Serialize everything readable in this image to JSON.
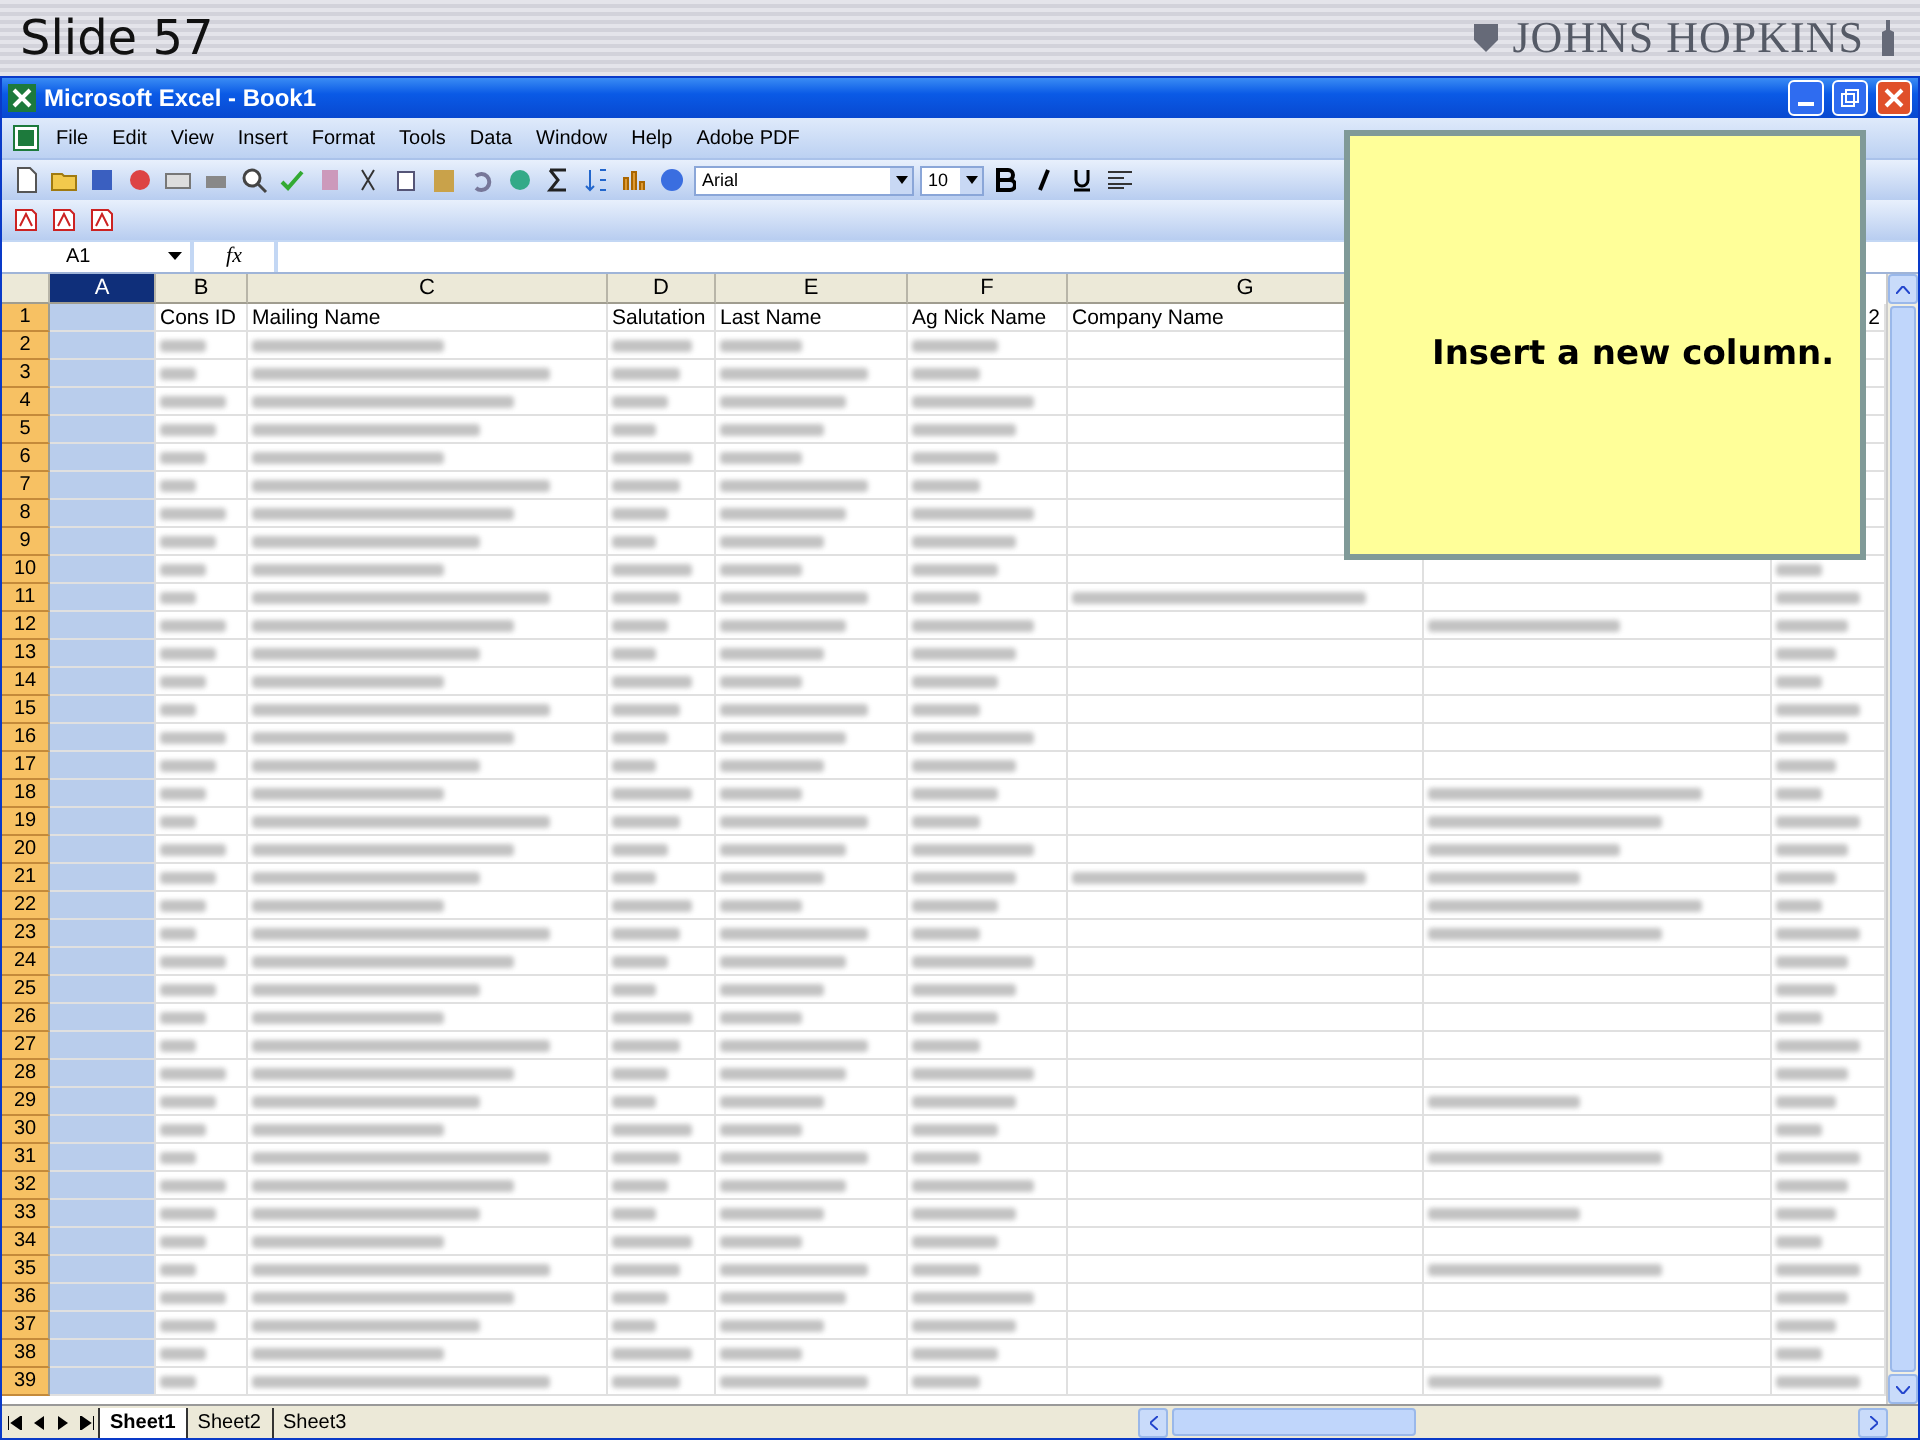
{
  "slide": {
    "title": "Slide 57",
    "logo": "JOHNS HOPKINS"
  },
  "window": {
    "title": "Microsoft Excel - Book1"
  },
  "menu": [
    "File",
    "Edit",
    "View",
    "Insert",
    "Format",
    "Tools",
    "Data",
    "Window",
    "Help",
    "Adobe PDF"
  ],
  "formatting": {
    "font": "Arial",
    "size": "10"
  },
  "name_box": "A1",
  "formula_label": "fx",
  "columns": [
    {
      "label": "A",
      "selected": true
    },
    {
      "label": "B",
      "selected": false
    },
    {
      "label": "C",
      "selected": false
    },
    {
      "label": "D",
      "selected": false
    },
    {
      "label": "E",
      "selected": false
    },
    {
      "label": "F",
      "selected": false
    },
    {
      "label": "G",
      "selected": false
    }
  ],
  "header_row": {
    "number": "1",
    "cells": [
      "",
      "Cons ID",
      "Mailing Name",
      "Salutation",
      "Last Name",
      "Ag Nick Name",
      "Company Name",
      "",
      "2"
    ]
  },
  "row_numbers": [
    "2",
    "3",
    "4",
    "5",
    "6",
    "7",
    "8",
    "9",
    "10",
    "11",
    "12",
    "13",
    "14",
    "15",
    "16",
    "17",
    "18",
    "19",
    "20",
    "21",
    "22",
    "23",
    "24",
    "25",
    "26",
    "27",
    "28",
    "29",
    "30",
    "31",
    "32",
    "33",
    "34",
    "35",
    "36",
    "37",
    "38",
    "39"
  ],
  "sheets": [
    {
      "label": "Sheet1",
      "selected": true
    },
    {
      "label": "Sheet2",
      "selected": false
    },
    {
      "label": "Sheet3",
      "selected": false
    }
  ],
  "note": {
    "text": "Insert a new column."
  }
}
